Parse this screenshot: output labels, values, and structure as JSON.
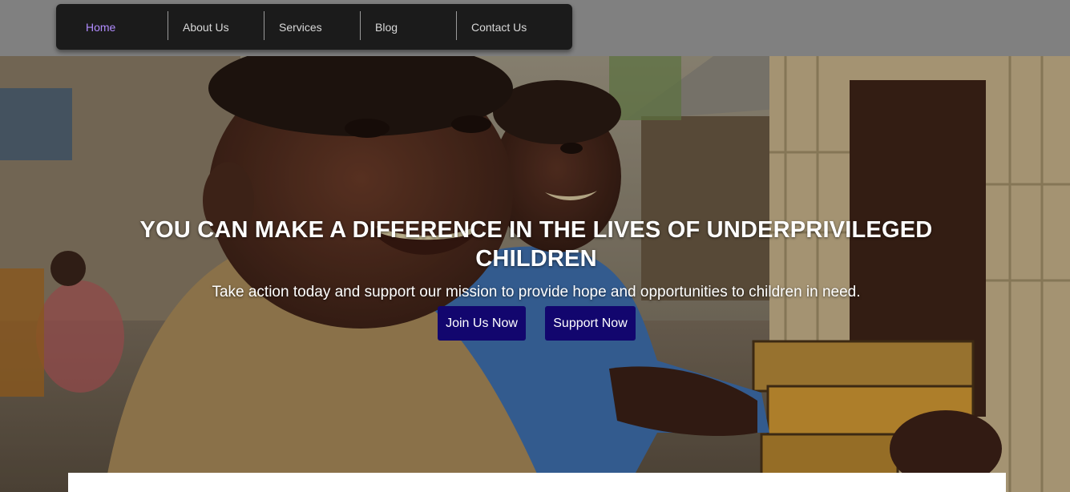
{
  "nav": {
    "items": [
      {
        "label": "Home",
        "active": true
      },
      {
        "label": "About Us",
        "active": false
      },
      {
        "label": "Services",
        "active": false
      },
      {
        "label": "Blog",
        "active": false
      },
      {
        "label": "Contact Us",
        "active": false
      }
    ],
    "active_color": "#b18cff"
  },
  "hero": {
    "title": "YOU CAN MAKE A DIFFERENCE IN THE LIVES OF UNDERPRIVILEGED CHILDREN",
    "subtitle": "Take action today and support our mission to provide hope and opportunities to children in need.",
    "buttons": {
      "join_label": "Join Us Now",
      "support_label": "Support Now"
    },
    "button_color": "#12066e"
  }
}
